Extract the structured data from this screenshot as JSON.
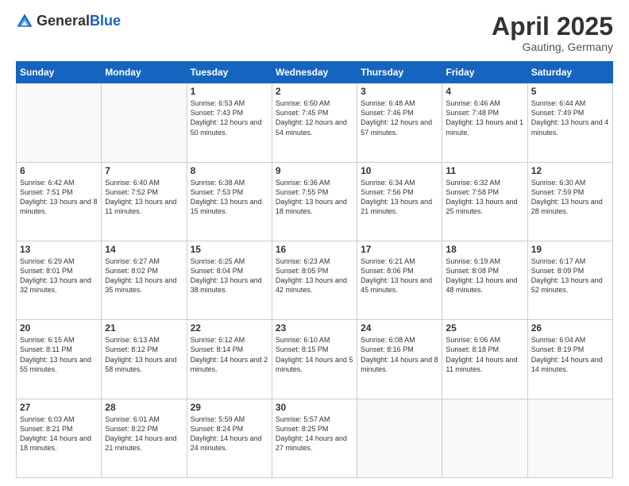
{
  "logo": {
    "general": "General",
    "blue": "Blue"
  },
  "header": {
    "month": "April 2025",
    "location": "Gauting, Germany"
  },
  "weekdays": [
    "Sunday",
    "Monday",
    "Tuesday",
    "Wednesday",
    "Thursday",
    "Friday",
    "Saturday"
  ],
  "weeks": [
    [
      {
        "day": "",
        "info": ""
      },
      {
        "day": "",
        "info": ""
      },
      {
        "day": "1",
        "info": "Sunrise: 6:53 AM\nSunset: 7:43 PM\nDaylight: 12 hours and 50 minutes."
      },
      {
        "day": "2",
        "info": "Sunrise: 6:50 AM\nSunset: 7:45 PM\nDaylight: 12 hours and 54 minutes."
      },
      {
        "day": "3",
        "info": "Sunrise: 6:48 AM\nSunset: 7:46 PM\nDaylight: 12 hours and 57 minutes."
      },
      {
        "day": "4",
        "info": "Sunrise: 6:46 AM\nSunset: 7:48 PM\nDaylight: 13 hours and 1 minute."
      },
      {
        "day": "5",
        "info": "Sunrise: 6:44 AM\nSunset: 7:49 PM\nDaylight: 13 hours and 4 minutes."
      }
    ],
    [
      {
        "day": "6",
        "info": "Sunrise: 6:42 AM\nSunset: 7:51 PM\nDaylight: 13 hours and 8 minutes."
      },
      {
        "day": "7",
        "info": "Sunrise: 6:40 AM\nSunset: 7:52 PM\nDaylight: 13 hours and 11 minutes."
      },
      {
        "day": "8",
        "info": "Sunrise: 6:38 AM\nSunset: 7:53 PM\nDaylight: 13 hours and 15 minutes."
      },
      {
        "day": "9",
        "info": "Sunrise: 6:36 AM\nSunset: 7:55 PM\nDaylight: 13 hours and 18 minutes."
      },
      {
        "day": "10",
        "info": "Sunrise: 6:34 AM\nSunset: 7:56 PM\nDaylight: 13 hours and 21 minutes."
      },
      {
        "day": "11",
        "info": "Sunrise: 6:32 AM\nSunset: 7:58 PM\nDaylight: 13 hours and 25 minutes."
      },
      {
        "day": "12",
        "info": "Sunrise: 6:30 AM\nSunset: 7:59 PM\nDaylight: 13 hours and 28 minutes."
      }
    ],
    [
      {
        "day": "13",
        "info": "Sunrise: 6:29 AM\nSunset: 8:01 PM\nDaylight: 13 hours and 32 minutes."
      },
      {
        "day": "14",
        "info": "Sunrise: 6:27 AM\nSunset: 8:02 PM\nDaylight: 13 hours and 35 minutes."
      },
      {
        "day": "15",
        "info": "Sunrise: 6:25 AM\nSunset: 8:04 PM\nDaylight: 13 hours and 38 minutes."
      },
      {
        "day": "16",
        "info": "Sunrise: 6:23 AM\nSunset: 8:05 PM\nDaylight: 13 hours and 42 minutes."
      },
      {
        "day": "17",
        "info": "Sunrise: 6:21 AM\nSunset: 8:06 PM\nDaylight: 13 hours and 45 minutes."
      },
      {
        "day": "18",
        "info": "Sunrise: 6:19 AM\nSunset: 8:08 PM\nDaylight: 13 hours and 48 minutes."
      },
      {
        "day": "19",
        "info": "Sunrise: 6:17 AM\nSunset: 8:09 PM\nDaylight: 13 hours and 52 minutes."
      }
    ],
    [
      {
        "day": "20",
        "info": "Sunrise: 6:15 AM\nSunset: 8:11 PM\nDaylight: 13 hours and 55 minutes."
      },
      {
        "day": "21",
        "info": "Sunrise: 6:13 AM\nSunset: 8:12 PM\nDaylight: 13 hours and 58 minutes."
      },
      {
        "day": "22",
        "info": "Sunrise: 6:12 AM\nSunset: 8:14 PM\nDaylight: 14 hours and 2 minutes."
      },
      {
        "day": "23",
        "info": "Sunrise: 6:10 AM\nSunset: 8:15 PM\nDaylight: 14 hours and 5 minutes."
      },
      {
        "day": "24",
        "info": "Sunrise: 6:08 AM\nSunset: 8:16 PM\nDaylight: 14 hours and 8 minutes."
      },
      {
        "day": "25",
        "info": "Sunrise: 6:06 AM\nSunset: 8:18 PM\nDaylight: 14 hours and 11 minutes."
      },
      {
        "day": "26",
        "info": "Sunrise: 6:04 AM\nSunset: 8:19 PM\nDaylight: 14 hours and 14 minutes."
      }
    ],
    [
      {
        "day": "27",
        "info": "Sunrise: 6:03 AM\nSunset: 8:21 PM\nDaylight: 14 hours and 18 minutes."
      },
      {
        "day": "28",
        "info": "Sunrise: 6:01 AM\nSunset: 8:22 PM\nDaylight: 14 hours and 21 minutes."
      },
      {
        "day": "29",
        "info": "Sunrise: 5:59 AM\nSunset: 8:24 PM\nDaylight: 14 hours and 24 minutes."
      },
      {
        "day": "30",
        "info": "Sunrise: 5:57 AM\nSunset: 8:25 PM\nDaylight: 14 hours and 27 minutes."
      },
      {
        "day": "",
        "info": ""
      },
      {
        "day": "",
        "info": ""
      },
      {
        "day": "",
        "info": ""
      }
    ]
  ]
}
